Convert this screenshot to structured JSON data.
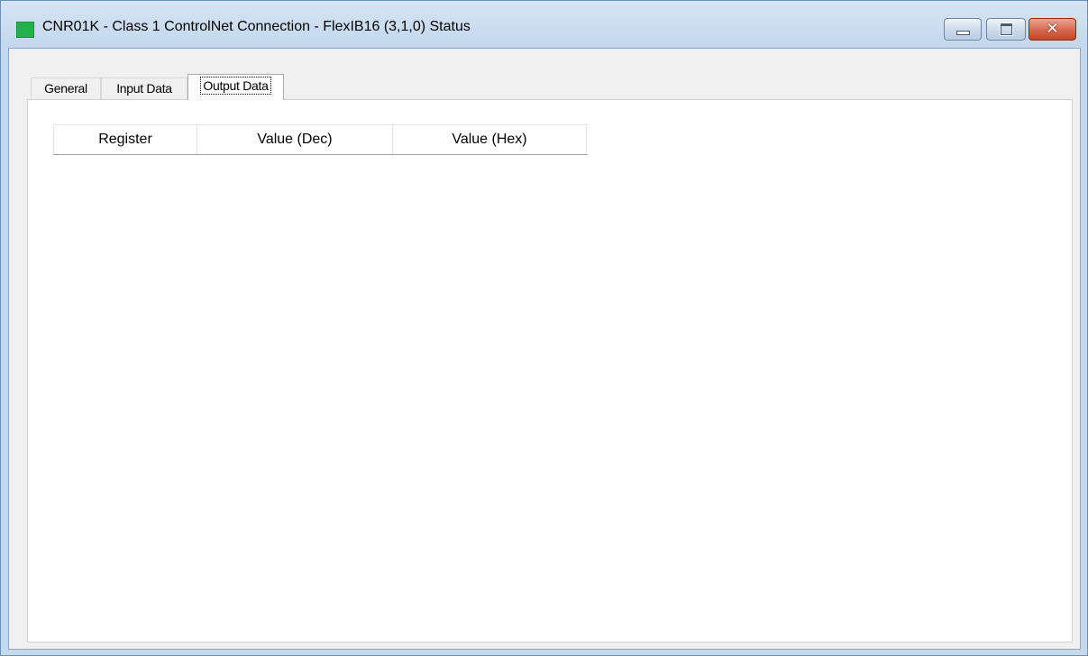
{
  "window": {
    "title": "CNR01K - Class 1 ControlNet Connection - FlexIB16 (3,1,0) Status",
    "status_icon_color": "#22b14c",
    "buttons": {
      "minimize_icon": "minimize-icon",
      "maximize_icon": "maximize-icon",
      "close_icon": "close-icon",
      "close_glyph": "✕"
    }
  },
  "tabs": [
    {
      "label": "General",
      "selected": false
    },
    {
      "label": "Input Data",
      "selected": false
    },
    {
      "label": "Output Data",
      "selected": true
    }
  ],
  "output_table": {
    "columns": [
      "Register",
      "Value (Dec)",
      "Value (Hex)"
    ],
    "rows": []
  }
}
